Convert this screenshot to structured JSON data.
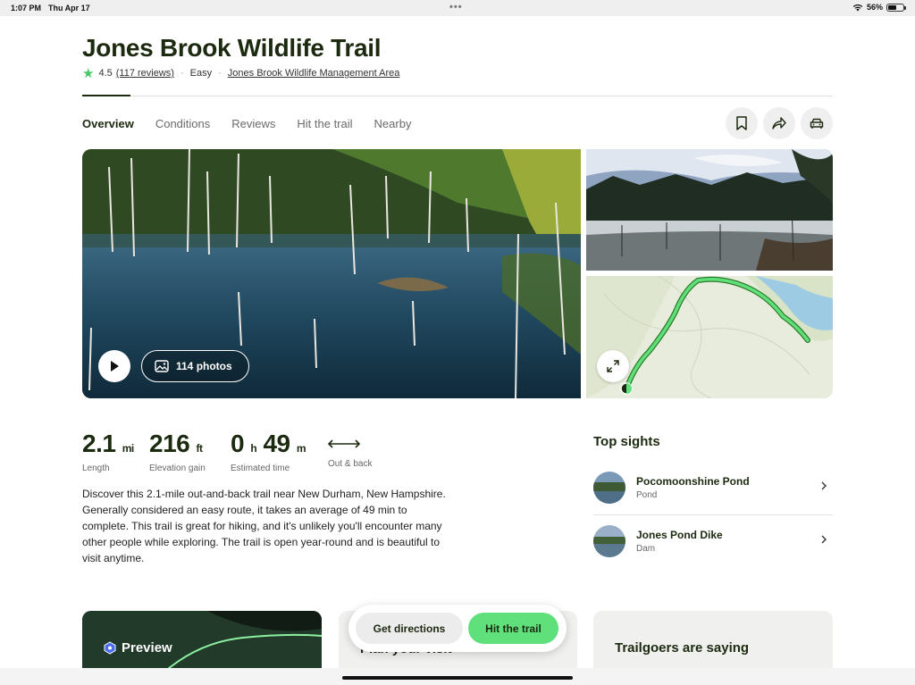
{
  "status_bar": {
    "time": "1:07 PM",
    "date": "Thu Apr 17",
    "battery": "56%",
    "battery_level": 0.56
  },
  "trail": {
    "title": "Jones Brook Wildlife Trail",
    "rating": "4.5",
    "reviews": "(117 reviews)",
    "difficulty": "Easy",
    "area": "Jones Brook Wildlife Management Area"
  },
  "tabs": [
    {
      "label": "Overview",
      "active": true
    },
    {
      "label": "Conditions"
    },
    {
      "label": "Reviews"
    },
    {
      "label": "Hit the trail"
    },
    {
      "label": "Nearby"
    }
  ],
  "actions": {
    "bookmark": "bookmark-icon",
    "share": "share-icon",
    "drive": "car-icon"
  },
  "media": {
    "photos_label": "114 photos"
  },
  "stats": {
    "length": {
      "value": "2.1",
      "unit": "mi",
      "label": "Length"
    },
    "elevation": {
      "value": "216",
      "unit": "ft",
      "label": "Elevation gain"
    },
    "time": {
      "hours": "0",
      "h_unit": "h",
      "minutes": "49",
      "m_unit": "m",
      "label": "Estimated time"
    },
    "route": {
      "label": "Out & back"
    }
  },
  "description": "Discover this 2.1-mile out-and-back trail near New Durham, New Hampshire. Generally considered an easy route, it takes an average of 49 min to complete. This trail is great for hiking, and it's unlikely you'll encounter many other people while exploring. The trail is open year-round and is beautiful to visit anytime.",
  "top_sights": {
    "title": "Top sights",
    "items": [
      {
        "name": "Pocomoonshine Pond",
        "type": "Pond"
      },
      {
        "name": "Jones Pond Dike",
        "type": "Dam"
      }
    ]
  },
  "cards": {
    "preview": "Preview",
    "plan": "Plan your visit",
    "saying": "Trailgoers are saying"
  },
  "cta": {
    "directions": "Get directions",
    "hit": "Hit the trail"
  },
  "colors": {
    "accent_green": "#5fe07a",
    "star": "#4cc46a",
    "text_dark": "#1c2a10"
  }
}
